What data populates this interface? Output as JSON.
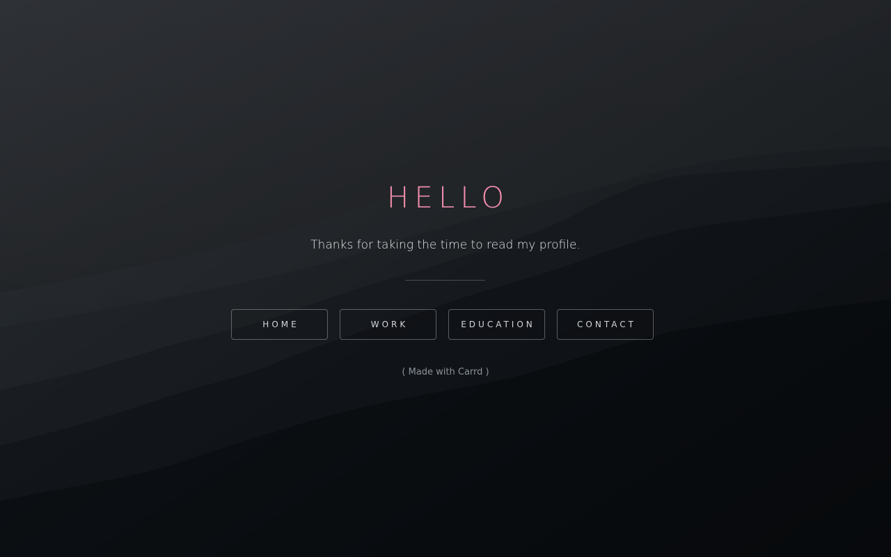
{
  "colors": {
    "title": "#f08cab",
    "background_top": "#2e3136",
    "background_bottom": "#05090c"
  },
  "hero": {
    "title": "HELLO",
    "subtitle": "Thanks for taking the time to read my profile."
  },
  "nav": {
    "items": [
      {
        "label": "HOME"
      },
      {
        "label": "WORK"
      },
      {
        "label": "EDUCATION"
      },
      {
        "label": "CONTACT"
      }
    ]
  },
  "footer": {
    "open": "(",
    "link_label": "Made with Carrd",
    "close": ")"
  }
}
